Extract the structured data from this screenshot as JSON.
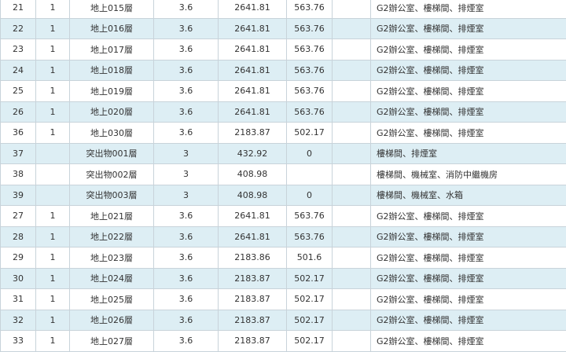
{
  "rows": [
    {
      "no": "21",
      "units": "1",
      "floor": "地上015層",
      "height": "3.6",
      "area": "2641.81",
      "area2": "563.76",
      "usage": "G2辦公室、樓梯間、排煙室"
    },
    {
      "no": "22",
      "units": "1",
      "floor": "地上016層",
      "height": "3.6",
      "area": "2641.81",
      "area2": "563.76",
      "usage": "G2辦公室、樓梯間、排煙室"
    },
    {
      "no": "23",
      "units": "1",
      "floor": "地上017層",
      "height": "3.6",
      "area": "2641.81",
      "area2": "563.76",
      "usage": "G2辦公室、樓梯間、排煙室"
    },
    {
      "no": "24",
      "units": "1",
      "floor": "地上018層",
      "height": "3.6",
      "area": "2641.81",
      "area2": "563.76",
      "usage": "G2辦公室、樓梯間、排煙室"
    },
    {
      "no": "25",
      "units": "1",
      "floor": "地上019層",
      "height": "3.6",
      "area": "2641.81",
      "area2": "563.76",
      "usage": "G2辦公室、樓梯間、排煙室"
    },
    {
      "no": "26",
      "units": "1",
      "floor": "地上020層",
      "height": "3.6",
      "area": "2641.81",
      "area2": "563.76",
      "usage": "G2辦公室、樓梯間、排煙室"
    },
    {
      "no": "36",
      "units": "1",
      "floor": "地上030層",
      "height": "3.6",
      "area": "2183.87",
      "area2": "502.17",
      "usage": "G2辦公室、樓梯間、排煙室"
    },
    {
      "no": "37",
      "units": "",
      "floor": "突出物001層",
      "height": "3",
      "area": "432.92",
      "area2": "0",
      "usage": "樓梯間、排煙室"
    },
    {
      "no": "38",
      "units": "",
      "floor": "突出物002層",
      "height": "3",
      "area": "408.98",
      "area2": "",
      "usage": "樓梯間、機械室、消防中繼機房"
    },
    {
      "no": "39",
      "units": "",
      "floor": "突出物003層",
      "height": "3",
      "area": "408.98",
      "area2": "0",
      "usage": "樓梯間、機械室、水箱"
    },
    {
      "no": "27",
      "units": "1",
      "floor": "地上021層",
      "height": "3.6",
      "area": "2641.81",
      "area2": "563.76",
      "usage": "G2辦公室、樓梯間、排煙室"
    },
    {
      "no": "28",
      "units": "1",
      "floor": "地上022層",
      "height": "3.6",
      "area": "2641.81",
      "area2": "563.76",
      "usage": "G2辦公室、樓梯間、排煙室"
    },
    {
      "no": "29",
      "units": "1",
      "floor": "地上023層",
      "height": "3.6",
      "area": "2183.86",
      "area2": "501.6",
      "usage": "G2辦公室、樓梯間、排煙室"
    },
    {
      "no": "30",
      "units": "1",
      "floor": "地上024層",
      "height": "3.6",
      "area": "2183.87",
      "area2": "502.17",
      "usage": "G2辦公室、樓梯間、排煙室"
    },
    {
      "no": "31",
      "units": "1",
      "floor": "地上025層",
      "height": "3.6",
      "area": "2183.87",
      "area2": "502.17",
      "usage": "G2辦公室、樓梯間、排煙室"
    },
    {
      "no": "32",
      "units": "1",
      "floor": "地上026層",
      "height": "3.6",
      "area": "2183.87",
      "area2": "502.17",
      "usage": "G2辦公室、樓梯間、排煙室"
    },
    {
      "no": "33",
      "units": "1",
      "floor": "地上027層",
      "height": "3.6",
      "area": "2183.87",
      "area2": "502.17",
      "usage": "G2辦公室、樓梯間、排煙室"
    }
  ],
  "colors": {
    "stripe": "#ddeef4",
    "border": "#c8d3da",
    "text": "#333333"
  }
}
